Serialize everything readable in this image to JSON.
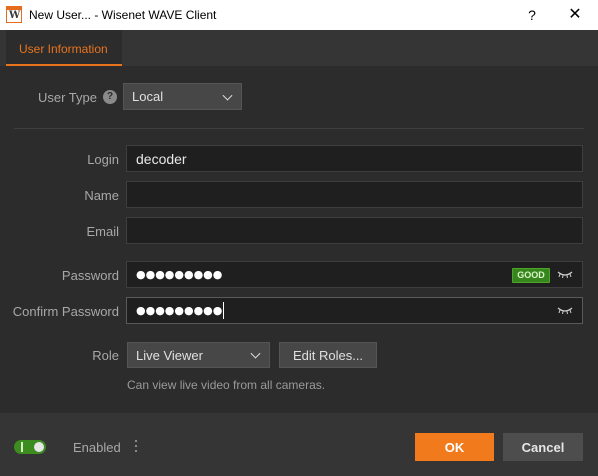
{
  "window": {
    "title": "New User... - Wisenet WAVE Client",
    "app_icon_letter": "W",
    "help_glyph": "?",
    "close_glyph": "✕"
  },
  "tabs": [
    {
      "label": "User Information",
      "active": true
    }
  ],
  "form": {
    "user_type": {
      "label": "User Type",
      "value": "Local",
      "help_glyph": "?"
    },
    "login": {
      "label": "Login",
      "value": "decoder"
    },
    "name": {
      "label": "Name",
      "value": ""
    },
    "email": {
      "label": "Email",
      "value": ""
    },
    "password": {
      "label": "Password",
      "masked_value": "●●●●●●●●●",
      "strength": "GOOD"
    },
    "confirm_password": {
      "label": "Confirm Password",
      "masked_value": "●●●●●●●●●"
    },
    "role": {
      "label": "Role",
      "value": "Live Viewer",
      "edit_button": "Edit Roles...",
      "description": "Can view live video from all cameras."
    }
  },
  "footer": {
    "enabled_label": "Enabled",
    "enabled": true,
    "ok_label": "OK",
    "cancel_label": "Cancel"
  },
  "colors": {
    "accent": "#f07a1c",
    "background": "#2c2c2c",
    "input_bg": "#1f1f1f",
    "good_badge": "#37861d",
    "toggle_on": "#3d8c1f"
  }
}
